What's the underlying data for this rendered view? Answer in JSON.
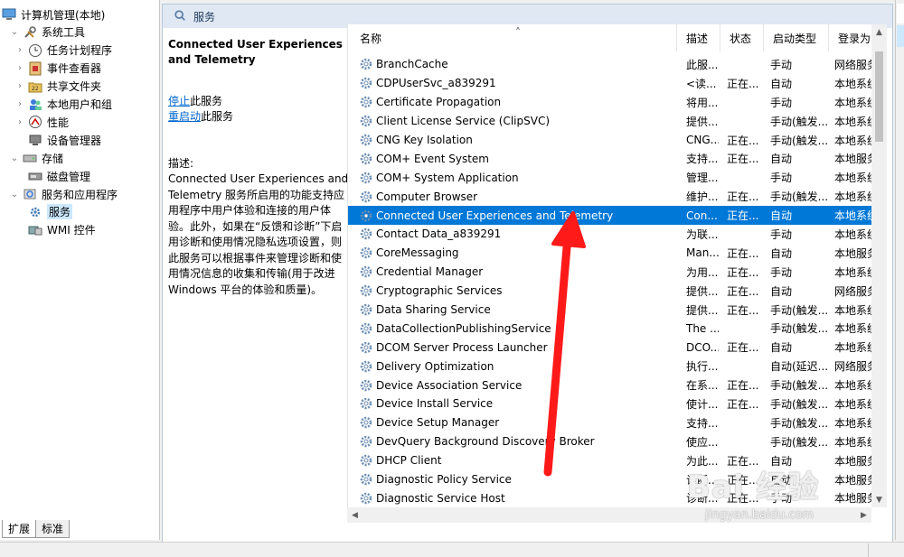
{
  "tree": {
    "items": [
      {
        "label": "计算机管理(本地)",
        "icon": "computer-icon",
        "indent": 0,
        "expander": ""
      },
      {
        "label": "系统工具",
        "icon": "tools-icon",
        "indent": 1,
        "expander": "⌄"
      },
      {
        "label": "任务计划程序",
        "icon": "clock-icon",
        "indent": 2,
        "expander": "›"
      },
      {
        "label": "事件查看器",
        "icon": "event-viewer-icon",
        "indent": 2,
        "expander": "›"
      },
      {
        "label": "共享文件夹",
        "icon": "shared-folder-icon",
        "indent": 2,
        "expander": "›"
      },
      {
        "label": "本地用户和组",
        "icon": "users-icon",
        "indent": 2,
        "expander": "›"
      },
      {
        "label": "性能",
        "icon": "performance-icon",
        "indent": 2,
        "expander": "›"
      },
      {
        "label": "设备管理器",
        "icon": "device-manager-icon",
        "indent": 2,
        "expander": ""
      },
      {
        "label": "存储",
        "icon": "storage-icon",
        "indent": 1,
        "expander": "⌄"
      },
      {
        "label": "磁盘管理",
        "icon": "disk-icon",
        "indent": 2,
        "expander": ""
      },
      {
        "label": "服务和应用程序",
        "icon": "services-apps-icon",
        "indent": 1,
        "expander": "⌄"
      },
      {
        "label": "服务",
        "icon": "services-icon",
        "indent": 2,
        "expander": "",
        "selected": true
      },
      {
        "label": "WMI 控件",
        "icon": "wmi-icon",
        "indent": 2,
        "expander": ""
      }
    ]
  },
  "header": {
    "title": "服务"
  },
  "description_pane": {
    "service_title": "Connected User Experiences and Telemetry",
    "stop_link": "停止",
    "stop_suffix": "此服务",
    "restart_link": "重启动",
    "restart_suffix": "此服务",
    "desc_label": "描述:",
    "desc_text": "Connected User Experiences and Telemetry 服务所启用的功能支持应用程序中用户体验和连接的用户体验。此外，如果在“反馈和诊断”下启用诊断和使用情况隐私选项设置，则此服务可以根据事件来管理诊断和使用情况信息的收集和传输(用于改进 Windows 平台的体验和质量)。"
  },
  "columns": {
    "name": "名称",
    "desc": "描述",
    "state": "状态",
    "startup": "启动类型",
    "logon": "登录为"
  },
  "services": [
    {
      "name": "BranchCache",
      "desc": "此服...",
      "state": "",
      "startup": "手动",
      "logon": "网络服务"
    },
    {
      "name": "CDPUserSvc_a839291",
      "desc": "<读...",
      "state": "正在...",
      "startup": "自动",
      "logon": "本地系统"
    },
    {
      "name": "Certificate Propagation",
      "desc": "将用...",
      "state": "",
      "startup": "手动",
      "logon": "本地系统"
    },
    {
      "name": "Client License Service (ClipSVC)",
      "desc": "提供...",
      "state": "",
      "startup": "手动(触发...",
      "logon": "本地系统"
    },
    {
      "name": "CNG Key Isolation",
      "desc": "CNG...",
      "state": "正在...",
      "startup": "手动(触发...",
      "logon": "本地系统"
    },
    {
      "name": "COM+ Event System",
      "desc": "支持...",
      "state": "正在...",
      "startup": "自动",
      "logon": "本地服务"
    },
    {
      "name": "COM+ System Application",
      "desc": "管理...",
      "state": "",
      "startup": "手动",
      "logon": "本地系统"
    },
    {
      "name": "Computer Browser",
      "desc": "维护...",
      "state": "正在...",
      "startup": "手动(触发...",
      "logon": "本地系统"
    },
    {
      "name": "Connected User Experiences and Telemetry",
      "desc": "Con...",
      "state": "正在...",
      "startup": "自动",
      "logon": "本地系统",
      "selected": true
    },
    {
      "name": "Contact Data_a839291",
      "desc": "为联...",
      "state": "",
      "startup": "手动",
      "logon": "本地系统"
    },
    {
      "name": "CoreMessaging",
      "desc": "Man...",
      "state": "正在...",
      "startup": "自动",
      "logon": "本地服务"
    },
    {
      "name": "Credential Manager",
      "desc": "为用...",
      "state": "正在...",
      "startup": "手动",
      "logon": "本地系统"
    },
    {
      "name": "Cryptographic Services",
      "desc": "提供...",
      "state": "正在...",
      "startup": "自动",
      "logon": "网络服务"
    },
    {
      "name": "Data Sharing Service",
      "desc": "提供...",
      "state": "正在...",
      "startup": "手动(触发...",
      "logon": "本地系统"
    },
    {
      "name": "DataCollectionPublishingService",
      "desc": "The ...",
      "state": "",
      "startup": "手动(触发...",
      "logon": "本地系统"
    },
    {
      "name": "DCOM Server Process Launcher",
      "desc": "DCO...",
      "state": "正在...",
      "startup": "自动",
      "logon": "本地系统"
    },
    {
      "name": "Delivery Optimization",
      "desc": "执行...",
      "state": "",
      "startup": "自动(延迟...",
      "logon": "网络服务"
    },
    {
      "name": "Device Association Service",
      "desc": "在系...",
      "state": "正在...",
      "startup": "手动(触发...",
      "logon": "本地系统"
    },
    {
      "name": "Device Install Service",
      "desc": "使计...",
      "state": "正在...",
      "startup": "手动(触发...",
      "logon": "本地系统"
    },
    {
      "name": "Device Setup Manager",
      "desc": "支持...",
      "state": "",
      "startup": "手动(触发...",
      "logon": "本地系统"
    },
    {
      "name": "DevQuery Background Discovery Broker",
      "desc": "使应...",
      "state": "",
      "startup": "手动(触发...",
      "logon": "本地系统"
    },
    {
      "name": "DHCP Client",
      "desc": "为此...",
      "state": "正在...",
      "startup": "自动",
      "logon": "本地服务"
    },
    {
      "name": "Diagnostic Policy Service",
      "desc": "诊断...",
      "state": "正在...",
      "startup": "自动",
      "logon": "本地服务"
    },
    {
      "name": "Diagnostic Service Host",
      "desc": "诊断...",
      "state": "正在...",
      "startup": "手动",
      "logon": "本地服务"
    }
  ],
  "tabs": [
    {
      "label": "扩展",
      "active": true
    },
    {
      "label": "标准",
      "active": false
    }
  ],
  "watermark": {
    "logo": "Bai 经验",
    "url": "jingyan.baidu.com"
  },
  "colors": {
    "selection": "#0078d7",
    "tree_selection": "#cce8ff",
    "header_bar": "#dfe8f3",
    "link": "#0066cc",
    "arrow": "#ff0000"
  }
}
